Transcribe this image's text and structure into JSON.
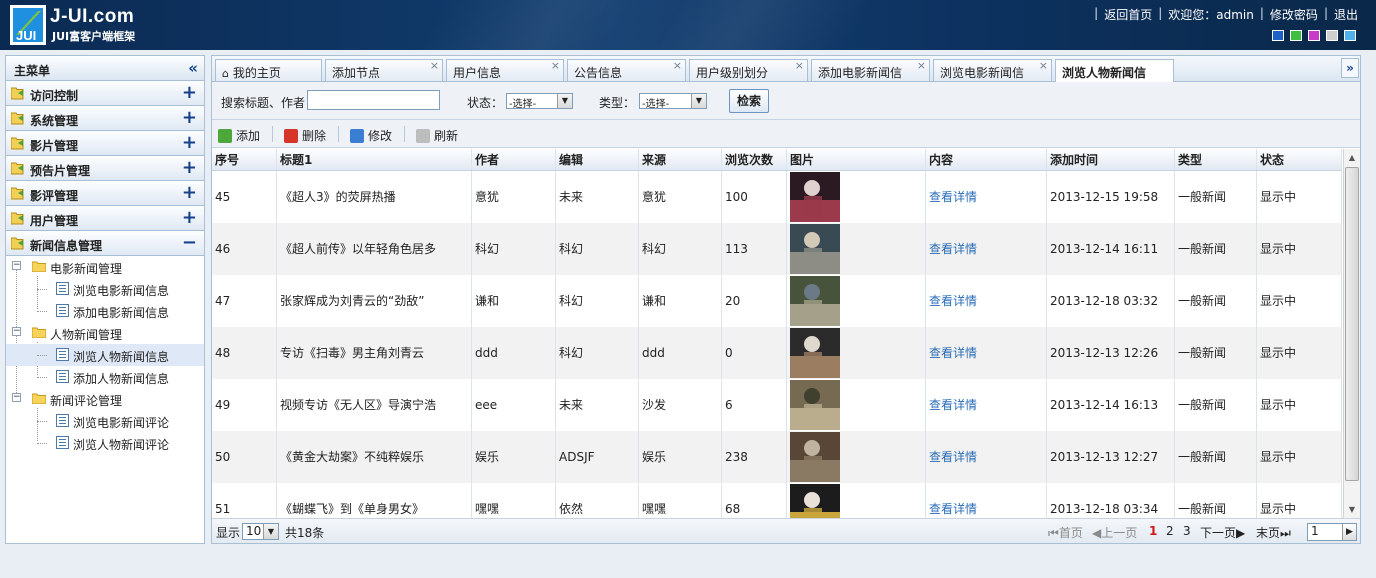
{
  "header": {
    "logo_title": "J-UI.com",
    "logo_sub": "JUI富客户端框架",
    "links": {
      "home": "返回首页",
      "welcome": "欢迎您：admin",
      "change_password": "修改密码",
      "logout": "退出"
    },
    "themes": [
      "#1e62c8",
      "#3fbf3f",
      "#c93cc9",
      "#cfcfcf",
      "#4fb1ea"
    ]
  },
  "sidebar": {
    "title": "主菜单",
    "accordion": [
      {
        "label": "访问控制",
        "sign": "+"
      },
      {
        "label": "系统管理",
        "sign": "+"
      },
      {
        "label": "影片管理",
        "sign": "+"
      },
      {
        "label": "预告片管理",
        "sign": "+"
      },
      {
        "label": "影评管理",
        "sign": "+"
      },
      {
        "label": "用户管理",
        "sign": "+"
      },
      {
        "label": "新闻信息管理",
        "sign": "−"
      }
    ],
    "tree": {
      "g1": "电影新闻管理",
      "g1_items": [
        "浏览电影新闻信息",
        "添加电影新闻信息"
      ],
      "g2": "人物新闻管理",
      "g2_items": [
        "浏览人物新闻信息",
        "添加人物新闻信息"
      ],
      "g3": "新闻评论管理",
      "g3_items": [
        "浏览电影新闻评论",
        "浏览人物新闻评论"
      ]
    }
  },
  "tabs": [
    "我的主页",
    "添加节点",
    "用户信息",
    "公告信息",
    "用户级别划分",
    "添加电影新闻信",
    "浏览电影新闻信",
    "浏览人物新闻信"
  ],
  "search": {
    "keyword_label": "搜索标题、作者",
    "keyword_value": "",
    "status_label": "状态：",
    "status_value": "-选择-",
    "type_label": "类型：",
    "type_value": "-选择-",
    "button": "检索"
  },
  "toolbar": {
    "add": "添加",
    "delete": "删除",
    "edit": "修改",
    "refresh": "刷新"
  },
  "table": {
    "columns": [
      "序号",
      "标题1",
      "作者",
      "编辑",
      "来源",
      "浏览次数",
      "图片",
      "内容",
      "添加时间",
      "类型",
      "状态"
    ],
    "rows": [
      {
        "id": "45",
        "title": "《超人3》的荧屏热播",
        "author": "意犹",
        "editor": "未来",
        "source": "意犹",
        "views": "100",
        "content": "查看详情",
        "time": "2013-12-15 19:58",
        "type": "一般新闻",
        "status": "显示中"
      },
      {
        "id": "46",
        "title": "《超人前传》以年轻角色居多",
        "author": "科幻",
        "editor": "科幻",
        "source": "科幻",
        "views": "113",
        "content": "查看详情",
        "time": "2013-12-14 16:11",
        "type": "一般新闻",
        "status": "显示中"
      },
      {
        "id": "47",
        "title": "张家辉成为刘青云的“劲敌”",
        "author": "谦和",
        "editor": "科幻",
        "source": "谦和",
        "views": "20",
        "content": "查看详情",
        "time": "2013-12-18 03:32",
        "type": "一般新闻",
        "status": "显示中"
      },
      {
        "id": "48",
        "title": "专访《扫毒》男主角刘青云",
        "author": "ddd",
        "editor": "科幻",
        "source": "ddd",
        "views": "0",
        "content": "查看详情",
        "time": "2013-12-13 12:26",
        "type": "一般新闻",
        "status": "显示中"
      },
      {
        "id": "49",
        "title": "视频专访《无人区》导演宁浩",
        "author": "eee",
        "editor": "未来",
        "source": "沙发",
        "views": "6",
        "content": "查看详情",
        "time": "2013-12-14 16:13",
        "type": "一般新闻",
        "status": "显示中"
      },
      {
        "id": "50",
        "title": "《黄金大劫案》不纯粹娱乐",
        "author": "娱乐",
        "editor": "ADSJF",
        "source": "娱乐",
        "views": "238",
        "content": "查看详情",
        "time": "2013-12-13 12:27",
        "type": "一般新闻",
        "status": "显示中"
      },
      {
        "id": "51",
        "title": "《蝴蝶飞》到《单身男女》",
        "author": "嘿嘿",
        "editor": "依然",
        "source": "嘿嘿",
        "views": "68",
        "content": "查看详情",
        "time": "2013-12-18 03:34",
        "type": "一般新闻",
        "status": "显示中"
      }
    ]
  },
  "pager": {
    "show_label": "显示",
    "page_size": "10",
    "total": "共18条",
    "first": "首页",
    "prev": "上一页",
    "pages": [
      "1",
      "2",
      "3"
    ],
    "next": "下一页",
    "last": "末页",
    "goto_value": "1"
  }
}
